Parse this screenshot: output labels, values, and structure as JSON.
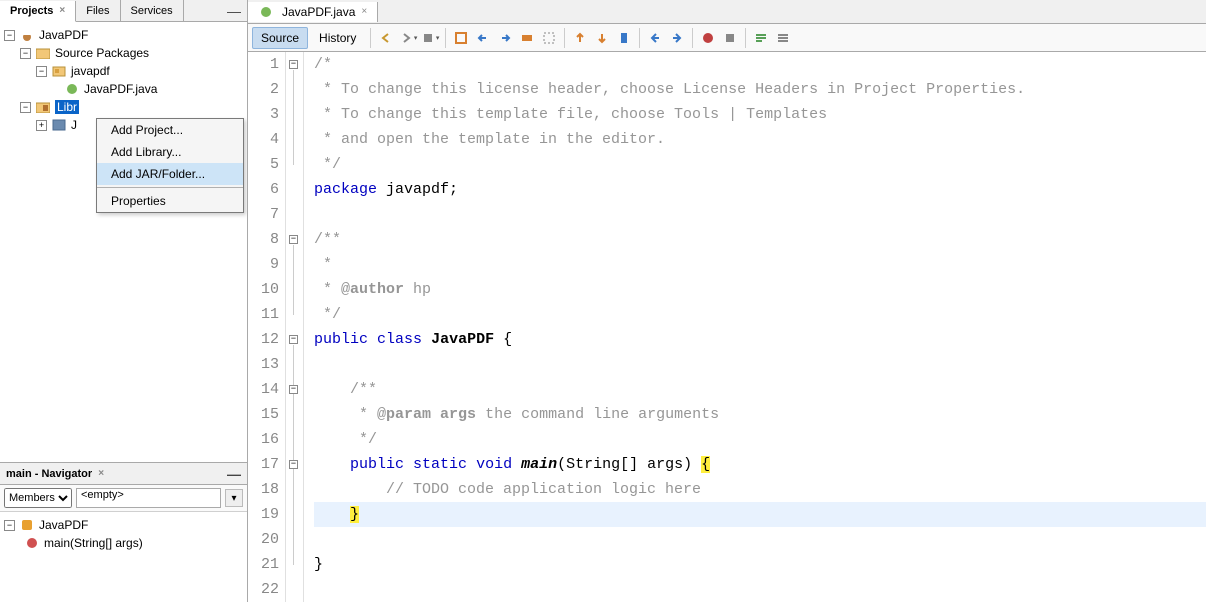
{
  "left_tabs": {
    "projects": "Projects",
    "files": "Files",
    "services": "Services"
  },
  "project_tree": {
    "root": "JavaPDF",
    "pkg_root": "Source Packages",
    "pkg": "javapdf",
    "file": "JavaPDF.java",
    "libraries": "Libr",
    "jdk": "J"
  },
  "context_menu": {
    "add_project": "Add Project...",
    "add_library": "Add Library...",
    "add_jar": "Add JAR/Folder...",
    "properties": "Properties"
  },
  "navigator": {
    "title": "main - Navigator",
    "members": "Members",
    "empty": "<empty>",
    "class": "JavaPDF",
    "method": "main(String[] args)"
  },
  "editor": {
    "tab": "JavaPDF.java",
    "source": "Source",
    "history": "History"
  },
  "code": {
    "l1": "/*",
    "l2": " * To change this license header, choose License Headers in Project Properties.",
    "l3": " * To change this template file, choose Tools | Templates",
    "l4": " * and open the template in the editor.",
    "l5": " */",
    "l6_a": "package",
    "l6_b": " javapdf;",
    "l7": "",
    "l8": "/**",
    "l9": " *",
    "l10_a": " * @",
    "l10_b": "author",
    "l10_c": " hp",
    "l11": " */",
    "l12_a": "public",
    "l12_b": " ",
    "l12_c": "class",
    "l12_d": " ",
    "l12_e": "JavaPDF",
    "l12_f": " {",
    "l13": "",
    "l14": "    /**",
    "l15_a": "     * @",
    "l15_b": "param",
    "l15_c": " ",
    "l15_d": "args",
    "l15_e": " the command line arguments",
    "l16": "     */",
    "l17_a": "    ",
    "l17_b": "public",
    "l17_c": " ",
    "l17_d": "static",
    "l17_e": " ",
    "l17_f": "void",
    "l17_g": " ",
    "l17_h": "main",
    "l17_i": "(String[] args) ",
    "l17_j": "{",
    "l18": "        // TODO code application logic here",
    "l19_a": "    ",
    "l19_b": "}",
    "l20": "",
    "l21": "}",
    "l22": ""
  }
}
